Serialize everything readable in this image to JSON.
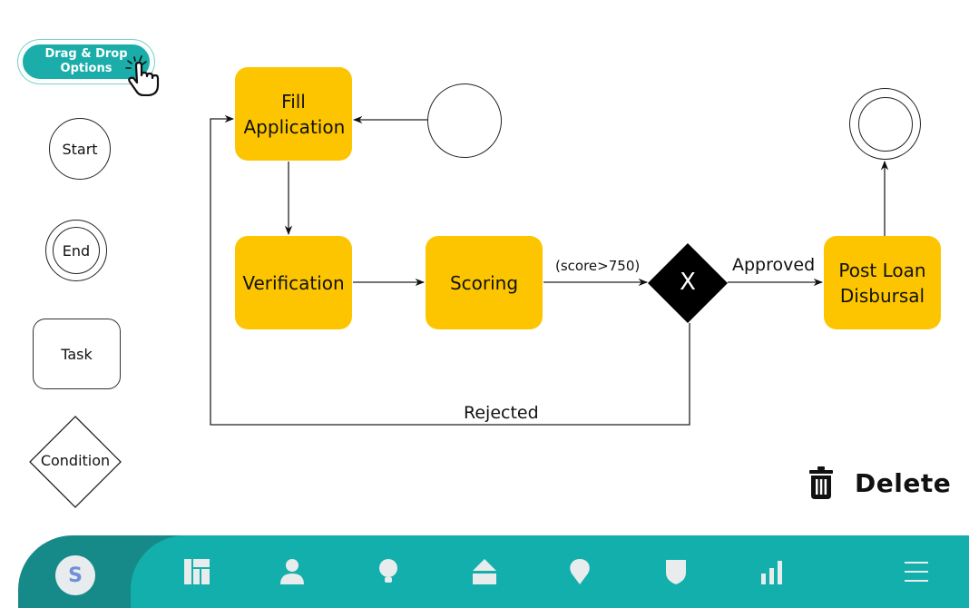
{
  "drag_drop": {
    "label_line1": "Drag & Drop",
    "label_line2": "Options"
  },
  "palette": {
    "start": "Start",
    "end": "End",
    "task": "Task",
    "condition": "Condition"
  },
  "diagram": {
    "tasks": {
      "fill_application": "Fill Application",
      "verification": "Verification",
      "scoring": "Scoring",
      "post_loan_disbursal": "Post Loan Disbursal"
    },
    "gateway_symbol": "X",
    "labels": {
      "condition": "(score>750)",
      "approved": "Approved",
      "rejected": "Rejected"
    },
    "colors": {
      "task_fill": "#fdc500",
      "gateway_fill": "#000000"
    }
  },
  "actions": {
    "delete_label": "Delete"
  },
  "bottom_nav": {
    "avatar_initial": "S",
    "items": [
      "dashboard-icon",
      "user-icon",
      "lightbulb-icon",
      "home-icon",
      "location-icon",
      "shield-icon",
      "bar-chart-icon",
      "menu-icon"
    ],
    "colors": {
      "primary": "#13afac",
      "dark": "#168a89"
    }
  }
}
